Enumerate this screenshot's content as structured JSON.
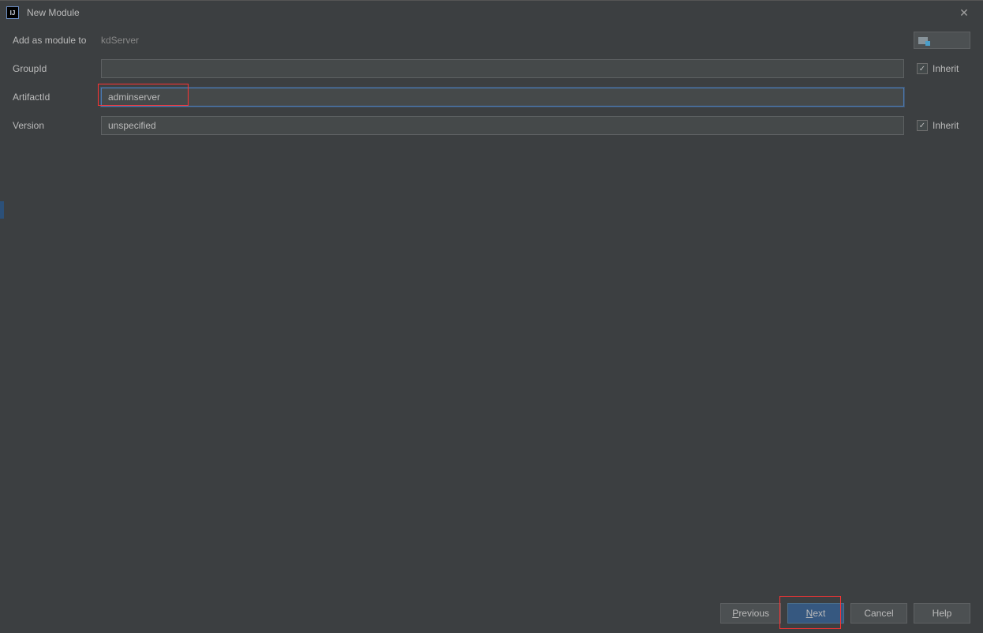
{
  "window": {
    "title": "New Module",
    "app_icon_text": "IJ"
  },
  "form": {
    "add_as_module_label": "Add as module to",
    "add_as_module_value": "kdServer",
    "group_id_label": "GroupId",
    "group_id_value": "",
    "artifact_id_label": "ArtifactId",
    "artifact_id_value": "adminserver",
    "version_label": "Version",
    "version_value": "unspecified",
    "inherit_label": "Inherit",
    "group_id_inherit_checked": true,
    "version_inherit_checked": true
  },
  "buttons": {
    "previous": "Previous",
    "next": "Next",
    "cancel": "Cancel",
    "help": "Help"
  }
}
